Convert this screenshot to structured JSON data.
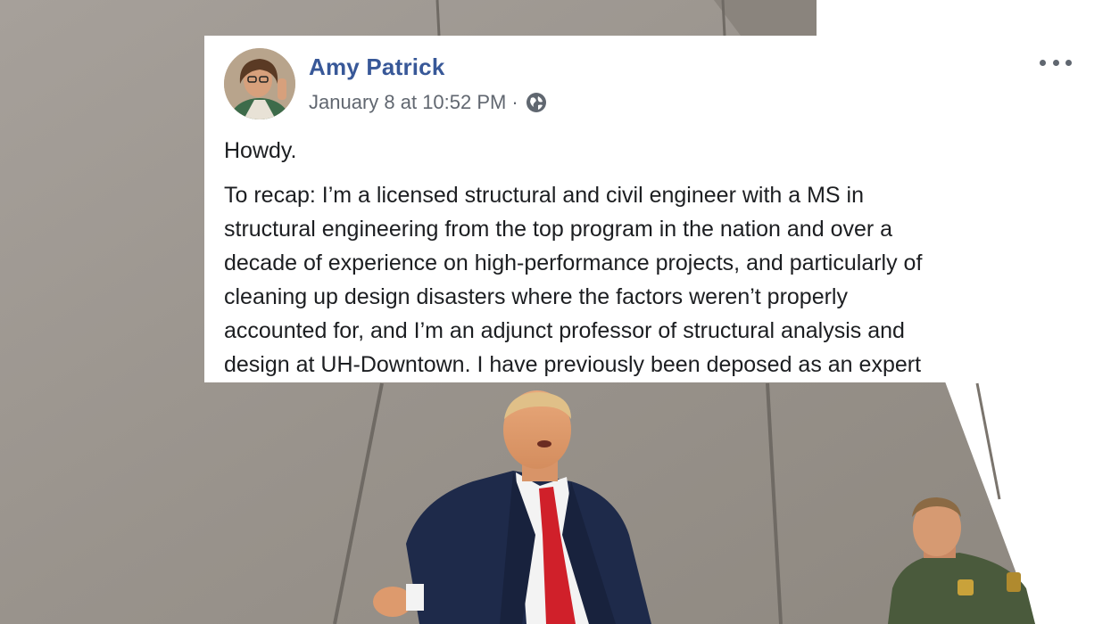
{
  "post": {
    "author_name": "Amy Patrick",
    "timestamp": "January 8 at 10:52 PM",
    "separator": "·",
    "privacy_icon": "globe-icon",
    "options_icon": "more-options-icon",
    "greeting": "Howdy.",
    "body_lines": [
      "To recap: I’m a licensed structural and civil engineer with a MS in",
      "structural engineering from the top program in the nation and over a",
      "decade of experience on high-performance projects, and particularly of",
      "cleaning up design disasters where the factors weren’t properly",
      "accounted for, and I’m an adjunct professor of structural analysis and",
      "design at UH-Downtown. I have previously been deposed as an expert"
    ]
  },
  "colors": {
    "author_link": "#385898",
    "meta_text": "#616770",
    "body_text": "#1c1e21",
    "wall": "#9a948d",
    "suit": "#1e2a4a",
    "tie": "#d0202a",
    "uniform": "#4a5a3c"
  }
}
